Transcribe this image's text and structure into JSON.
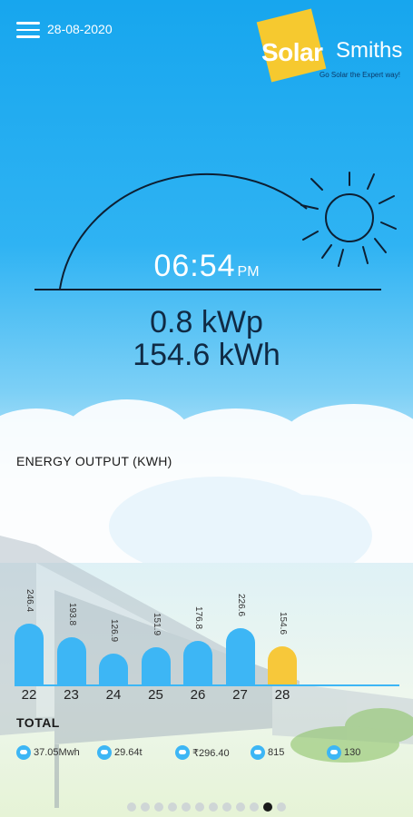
{
  "header": {
    "date": "28-08-2020"
  },
  "logo": {
    "word1": "Solar",
    "word2": "Smiths",
    "tagline": "Go Solar the Expert way!"
  },
  "time": {
    "hhmm": "06:54",
    "ampm": "PM"
  },
  "readings": {
    "power": "0.8 kWp",
    "energy": "154.6 kWh"
  },
  "energy_output": {
    "title": "ENERGY OUTPUT (KWH)",
    "days": [
      "22",
      "23",
      "24",
      "25",
      "26",
      "27",
      "28"
    ],
    "values": [
      "246.4",
      "193.8",
      "126.9",
      "151.9",
      "176.8",
      "226.6",
      "154.6"
    ],
    "accent": "#3db6f5",
    "active_color": "#f7c83a"
  },
  "total": {
    "title": "TOTAL",
    "stats": [
      "37.05Mwh",
      "29.64t",
      "₹296.40",
      "815",
      "130"
    ]
  },
  "pager": {
    "count": 12,
    "active_index": 10
  }
}
